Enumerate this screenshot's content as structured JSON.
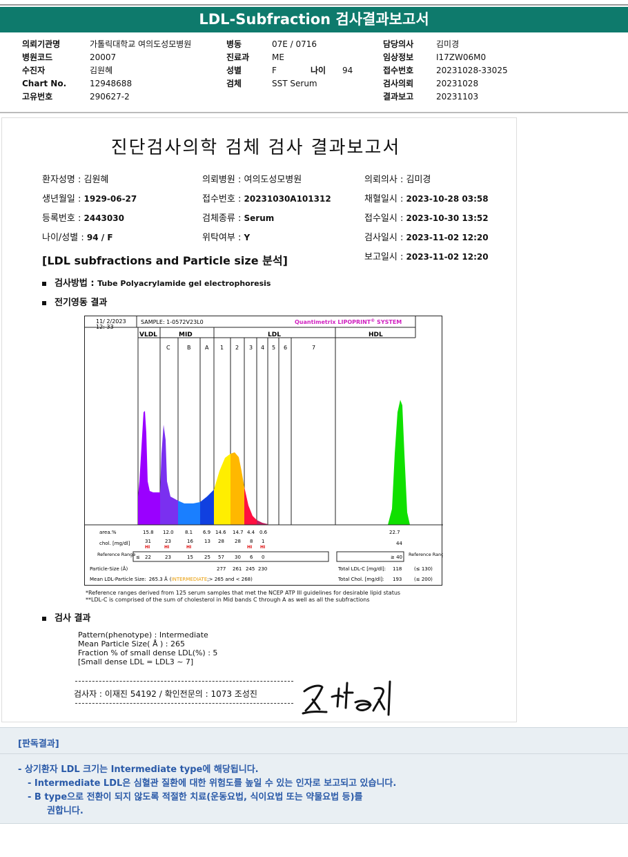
{
  "banner": {
    "title": "LDL-Subfraction 검사결과보고서"
  },
  "info": {
    "col1": [
      {
        "label": "의뢰기관명",
        "value": "가톨릭대학교 여의도성모병원"
      },
      {
        "label": "병원코드",
        "value": "20007"
      },
      {
        "label": "수진자",
        "value": "김원혜"
      },
      {
        "label": "Chart No.",
        "value": "12948688"
      },
      {
        "label": "고유번호",
        "value": "290627-2"
      }
    ],
    "col2": [
      {
        "label": "병동",
        "value": "07E / 0716"
      },
      {
        "label": "진료과",
        "value": "ME"
      },
      {
        "label": "성별",
        "value": "F"
      },
      {
        "label": "검체",
        "value": "SST Serum"
      }
    ],
    "age_label": "나이",
    "age_value": "94",
    "col3": [
      {
        "label": "담당의사",
        "value": "김미경"
      },
      {
        "label": "임상정보",
        "value": "I17ZW06M0"
      },
      {
        "label": "접수번호",
        "value": "20231028-33025"
      },
      {
        "label": "검사의뢰",
        "value": "20231028"
      },
      {
        "label": "결과보고",
        "value": "20231103"
      }
    ]
  },
  "doc": {
    "title": "진단검사의학 검체 검사 결과보고서",
    "fields": [
      {
        "label": "환자성명 : ",
        "value": "김원혜"
      },
      {
        "label": "의뢰병원 : ",
        "value": "여의도성모병원"
      },
      {
        "label": "의뢰의사 : ",
        "value": "김미경"
      },
      {
        "label": "생년월일 : ",
        "value": "1929-06-27"
      },
      {
        "label": "접수번호 : ",
        "value": "20231030A101312"
      },
      {
        "label": "채혈일시 : ",
        "value": "2023-10-28 03:58"
      },
      {
        "label": "등록번호 : ",
        "value": "2443030"
      },
      {
        "label": "검체종류 : ",
        "value": "Serum"
      },
      {
        "label": "접수일시 : ",
        "value": "2023-10-30 13:52"
      },
      {
        "label": "나이/성별 : ",
        "value": "94 / F"
      },
      {
        "label": "위탁여부 : ",
        "value": "Y"
      },
      {
        "label": "검사일시 : ",
        "value": "2023-11-02 12:20"
      },
      {
        "label": "보고일시 : ",
        "value": "2023-11-02 12:20"
      }
    ],
    "section": "[LDL subfractions and Particle size 분석]",
    "method_label": "검사방법 : ",
    "method_value": "Tube Polyacrylamide gel electrophoresis",
    "gel_label": "전기영동 결과",
    "result_label": "검사 결과",
    "gel": {
      "date": "11/ 2/2023",
      "time": "12: 33",
      "sample": "SAMPLE:  1-0572V23L0",
      "brand": "Quantimetrix LIPOPRINT",
      "brand_reg": "®",
      "brand_sys": " SYSTEM",
      "groups": [
        "VLDL",
        "MID",
        "LDL",
        "HDL"
      ],
      "bands": [
        "C",
        "B",
        "A",
        "1",
        "2",
        "3",
        "4",
        "5",
        "6",
        "7"
      ],
      "row_area_label": "area.%",
      "row_chol_label": "chol. [mg/dl]",
      "row_ref_label": "Reference Range",
      "area": [
        "15.8",
        "12.0",
        "8.1",
        "6.9",
        "14.6",
        "14.7",
        "4.4",
        "0.6",
        "22.7"
      ],
      "chol": [
        "31",
        "23",
        "16",
        "13",
        "28",
        "28",
        "8",
        "1",
        "44"
      ],
      "hi": "HI",
      "ref": [
        "≤",
        "22",
        "23",
        "15",
        "25",
        "57",
        "30",
        "6",
        "0",
        "≥ 40"
      ],
      "ref_right": "Reference Range",
      "particle_label": "Particle-Size (Å)",
      "particle": [
        "277",
        "261",
        "245",
        "230"
      ],
      "mean_label": "Mean LDL-Particle Size:",
      "mean_value": "265.3 Å",
      "mean_open": "(",
      "mean_type": "INTERMEDIATE",
      "mean_rest": ";> 265 and < 268)",
      "total_ldl_label": "Total LDL-C [mg/dl]:",
      "total_ldl_value": "118",
      "total_ldl_ref": "(≤ 130)",
      "total_chol_label": "Total Chol. [mg/dl]:",
      "total_chol_value": "193",
      "total_chol_ref": "(≤ 200)"
    },
    "footnotes": [
      "*Reference ranges derived from 125 serum samples that met the NCEP ATP III guidelines for desirable lipid status",
      "**LDL-C is comprised of the sum of cholesterol in Mid bands C through A as well as all the subfractions"
    ],
    "results": [
      "Pattern(phenotype) : Intermediate",
      "Mean Particle Size( Å ) : 265",
      "Fraction % of small dense LDL(%) : 5",
      "[Small dense LDL = LDL3 ~ 7]"
    ],
    "signline": "검사자 : 이재진  54192  /  확인전문의 : 1073  조성진"
  },
  "interp": {
    "title": "[판독결과]",
    "lines": [
      "-  상기환자 LDL 크기는 Intermediate type에 해당됩니다.",
      "-  Intermediate LDL은 심혈관 질환에 대한 위험도를 높일 수 있는 인자로 보고되고 있습니다.",
      "-  B type으로 전환이 되지 않도록 적절한 치료(운동요법, 식이요법 또는 약물요법 등)를",
      "권합니다."
    ]
  },
  "colors": {
    "banner": "#0e7a6c",
    "interp_text": "#2a5aa8",
    "brand": "#d020c0",
    "hi": "#e01010",
    "intermediate": "#e89a00"
  }
}
